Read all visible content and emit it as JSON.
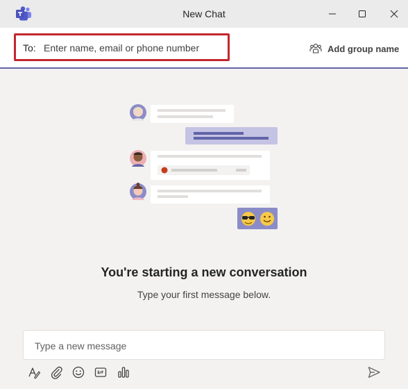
{
  "window": {
    "title": "New Chat",
    "icons": [
      "teams-logo",
      "minimize-icon",
      "maximize-icon",
      "close-icon"
    ]
  },
  "to_bar": {
    "label": "To:",
    "placeholder": "Enter name, email or phone number",
    "value": "",
    "add_group_label": "Add group name",
    "highlight_color": "#c4262e"
  },
  "empty_state": {
    "heading": "You're starting a new conversation",
    "subheading": "Type your first message below."
  },
  "composer": {
    "placeholder": "Type a new message",
    "value": "",
    "toolbar": [
      "format-icon",
      "attach-icon",
      "emoji-icon",
      "gif-icon",
      "poll-icon",
      "send-icon"
    ]
  },
  "colors": {
    "accent": "#6264a7",
    "background": "#f3f2f1",
    "titlebar": "#ebebeb"
  }
}
